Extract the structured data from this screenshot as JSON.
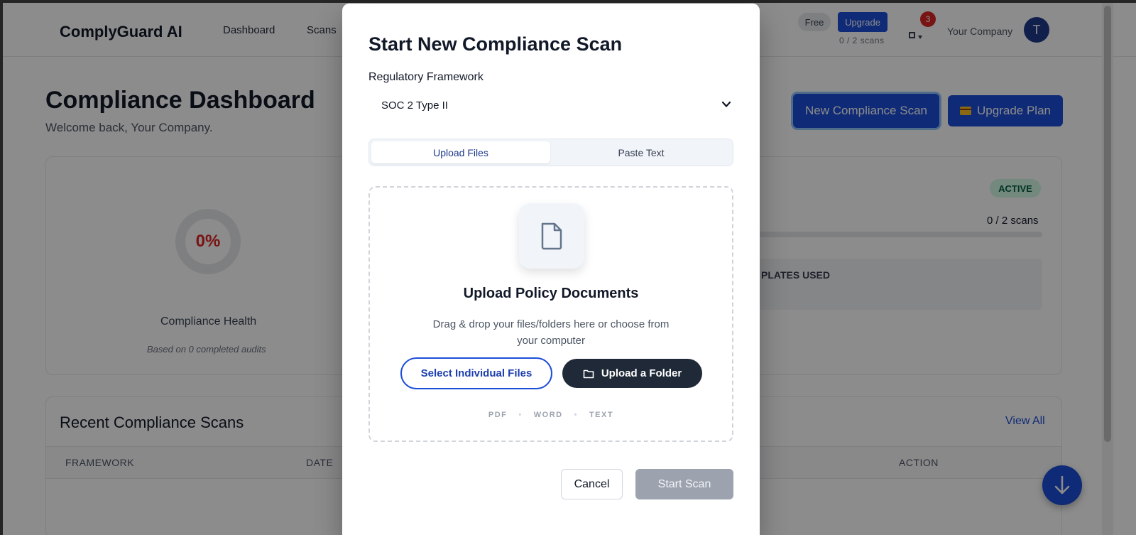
{
  "app": {
    "brand": "ComplyGuard AI",
    "nav": [
      "Dashboard",
      "Scans"
    ],
    "plan": "Free",
    "upgrade_label": "Upgrade",
    "scans_usage": "0 / 2 scans",
    "notification_count": "3",
    "company": "Your Company",
    "avatar_initial": "T"
  },
  "dashboard": {
    "title": "Compliance Dashboard",
    "welcome": "Welcome back, Your Company.",
    "new_scan_label": "New Compliance Scan",
    "upgrade_plan_label": "Upgrade Plan",
    "health_value": "0%",
    "health_label": "Compliance Health",
    "health_sub": "Based on 0 completed audits",
    "status_badge": "ACTIVE",
    "usage": "0 / 2 scans",
    "templates_label": "PLATES USED",
    "recent_title": "Recent Compliance Scans",
    "view_all": "View All",
    "table_headers": [
      "FRAMEWORK",
      "DATE",
      "ACTION"
    ]
  },
  "modal": {
    "title": "Start New Compliance Scan",
    "framework_label": "Regulatory Framework",
    "framework_value": "SOC 2 Type II",
    "tabs": [
      "Upload Files",
      "Paste Text"
    ],
    "upload_heading": "Upload Policy Documents",
    "upload_desc": "Drag & drop your files/folders here or choose from your computer",
    "select_files_label": "Select Individual Files",
    "upload_folder_label": "Upload a Folder",
    "formats": [
      "PDF",
      "WORD",
      "TEXT"
    ],
    "cancel_label": "Cancel",
    "start_label": "Start Scan"
  },
  "colors": {
    "primary": "#1d4ed8",
    "danger": "#dc2626",
    "dark": "#1f2937",
    "disabled": "#9ca3af",
    "success_bg": "#d1fae5"
  }
}
